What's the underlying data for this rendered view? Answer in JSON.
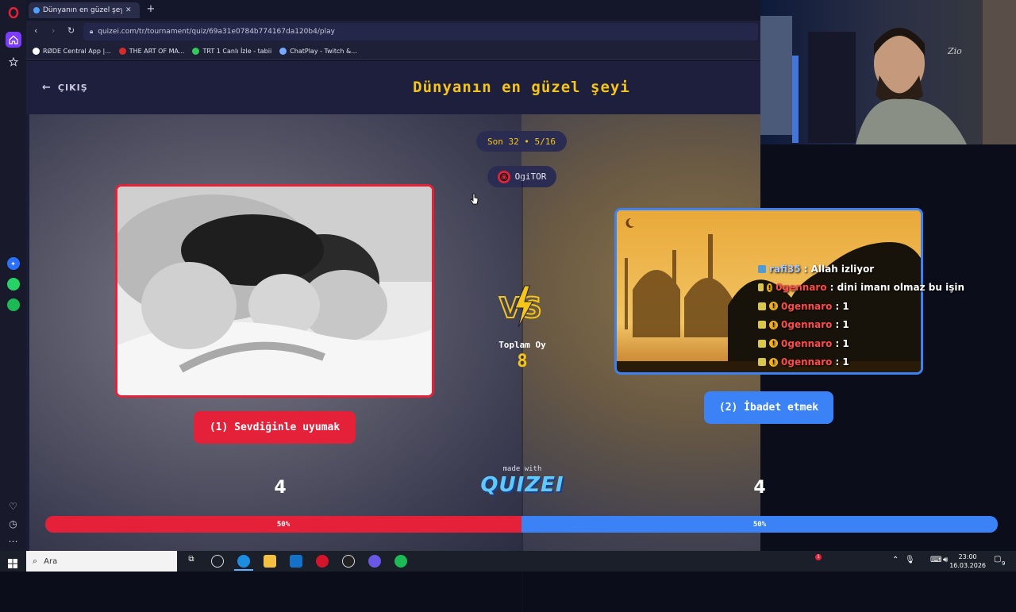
{
  "browser": {
    "tab_title": "Dünyanın en güzel şeyi -",
    "new_tab_symbol": "+",
    "url": "quizei.com/tr/tournament/quiz/69a31e0784b774167da120b4/play",
    "bookmarks": [
      {
        "label": "RØDE Central App |...",
        "icon": "rode-icon",
        "color": "#ffffff"
      },
      {
        "label": "THE ART OF MA...",
        "icon": "art-icon",
        "color": "#d62b2b"
      },
      {
        "label": "TRT 1 Canlı İzle - tabii",
        "icon": "tabii-icon",
        "color": "#34c759"
      },
      {
        "label": "ChatPlay - Twitch &...",
        "icon": "chatplay-icon",
        "color": "#7aa7ff"
      }
    ]
  },
  "page": {
    "exit_label": "ÇIKIŞ",
    "title": "Dünyanın en güzel şeyi",
    "round_label": "Son 32 • 5/16",
    "author": "OgiTOR",
    "total_label": "Toplam Oy",
    "total_value": "8",
    "made_with": "made with",
    "brand": "QUIZEI",
    "vs_label": "VS"
  },
  "options": {
    "left": {
      "label": "(1) Sevdiğinle uyumak",
      "votes": "4",
      "percent_label": "50%",
      "percent": 50,
      "color": "#e5213a"
    },
    "right": {
      "label": "(2) İbadet etmek",
      "votes": "4",
      "percent_label": "50%",
      "percent": 50,
      "color": "#3b82f6"
    }
  },
  "chat": [
    {
      "user": "rafi35",
      "message": ": Allah izliyor",
      "badge": "blue",
      "coin": false
    },
    {
      "user": "0gennaro",
      "message": ": dini imanı olmaz bu işin",
      "badge": "yellow",
      "coin": true
    },
    {
      "user": "0gennaro",
      "message": ": 1",
      "badge": "yellow",
      "coin": true
    },
    {
      "user": "0gennaro",
      "message": ": 1",
      "badge": "yellow",
      "coin": true
    },
    {
      "user": "0gennaro",
      "message": ": 1",
      "badge": "yellow",
      "coin": true
    },
    {
      "user": "0gennaro",
      "message": ": 1",
      "badge": "yellow",
      "coin": true
    }
  ],
  "webcam": {
    "brand_text": "Zio"
  },
  "taskbar": {
    "search_placeholder": "Ara",
    "time": "23:00",
    "date": "16.03.2026",
    "notification_count": "9",
    "alert_badge": "1"
  },
  "colors": {
    "accent_yellow": "#f5c518",
    "header_bg": "#1e1f3d",
    "red": "#e5213a",
    "blue": "#3b82f6"
  }
}
